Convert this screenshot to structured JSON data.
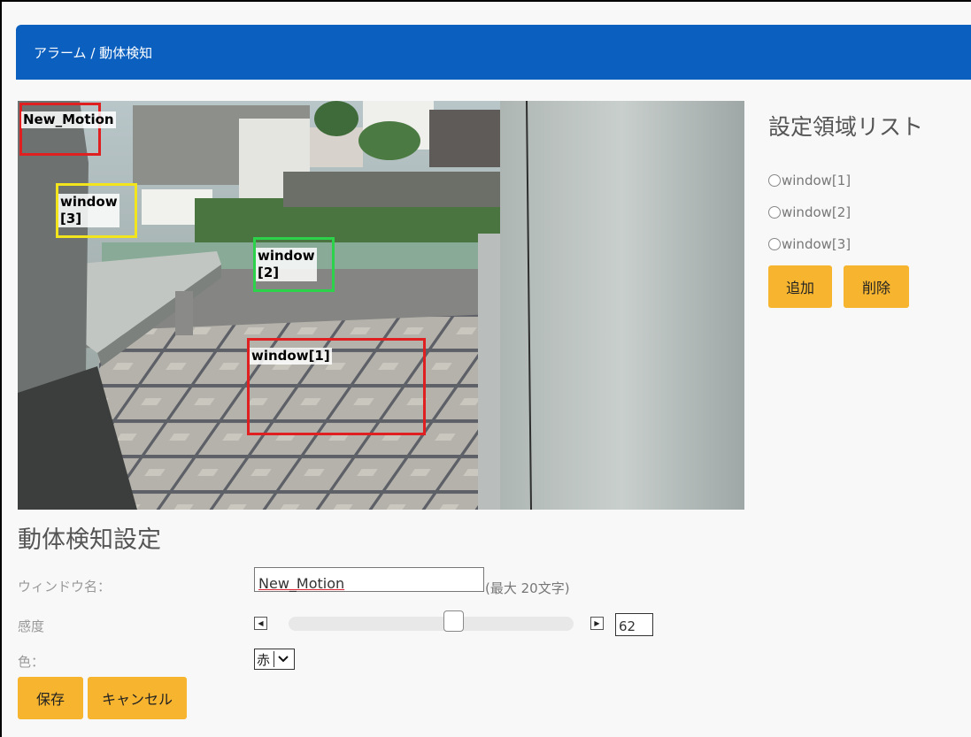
{
  "breadcrumb": "アラーム / 動体検知",
  "video": {
    "zones": [
      {
        "label": "New_Motion",
        "color": "#e02020"
      },
      {
        "label": "window\n[3]",
        "color": "#f2e51d"
      },
      {
        "label": "window\n[2]",
        "color": "#2bd24a"
      },
      {
        "label": "window[1]",
        "color": "#e02020"
      }
    ]
  },
  "region_list": {
    "title": "設定領域リスト",
    "items": [
      "window[1]",
      "window[2]",
      "window[3]"
    ],
    "add_label": "追加",
    "delete_label": "削除"
  },
  "settings": {
    "title": "動体検知設定",
    "window_name_label": "ウィンドウ名：",
    "window_name_value": "New_Motion",
    "window_name_hint": "(最大 20文字)",
    "sensitivity_label": "感度",
    "sensitivity_value": "62",
    "sensitivity_fraction": 0.62,
    "color_label": "色：",
    "color_value": "赤",
    "save_label": "保存",
    "cancel_label": "キャンセル"
  },
  "colors": {
    "header": "#0a5fbf",
    "button": "#f6b42f"
  }
}
